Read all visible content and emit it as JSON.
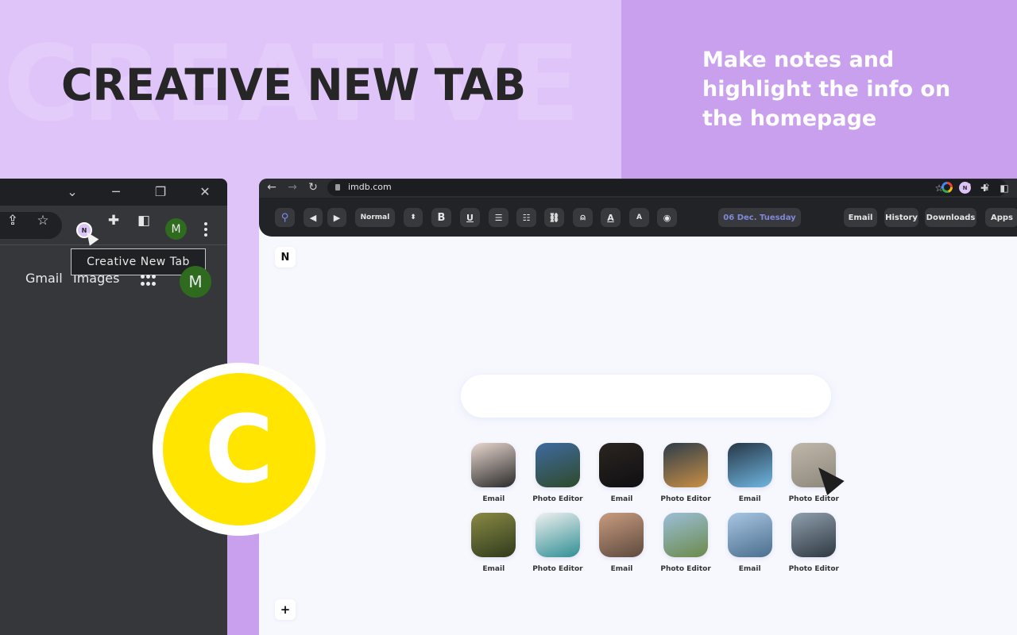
{
  "hero": {
    "watermark": "CREATIVE",
    "title": "CREATIVE NEW TAB",
    "tagline": "Make notes and highlight the info on the homepage"
  },
  "colors": {
    "bg_light_purple": "#dfc4fa",
    "bg_purple": "#c8a0ee",
    "logo_yellow": "#ffe500",
    "date_accent": "#8088d9",
    "search_icon_accent": "#7b8cf0",
    "dark_window": "#36373b"
  },
  "left_browser": {
    "window_controls": [
      "tab-search",
      "minimize",
      "restore",
      "close"
    ],
    "toolbar_icons": [
      "share-icon",
      "star-icon",
      "extension-badge",
      "puzzle-icon",
      "side-panel-icon",
      "profile-avatar",
      "more-menu-icon"
    ],
    "extension_badge_letter": "N",
    "profile_initial": "M",
    "tooltip": "Creative New Tab",
    "links": {
      "gmail": "Gmail",
      "images": "Images"
    },
    "account_initial": "M"
  },
  "main_browser": {
    "url": "imdb.com",
    "extension_badge_letter": "N",
    "toolbar": {
      "search_icon": "search-icon",
      "prev_icon": "prev-icon",
      "next_icon": "next-icon",
      "text_style": "Normal",
      "size_icon": "size-stepper-icon",
      "bold": "B",
      "underline": "U",
      "bullet_list": "bullet-list-icon",
      "numbered_list": "numbered-list-icon",
      "link": "link-icon",
      "reminder": "bell-icon",
      "text_color": "A",
      "highlight": "A",
      "preview": "eye-icon"
    },
    "date": "06 Dec. Tuesday",
    "quick_links": [
      "Email",
      "History",
      "Downloads",
      "Apps"
    ],
    "note_button": "N",
    "add_button": "+",
    "search": {
      "value": "",
      "placeholder": ""
    },
    "tiles": [
      {
        "label": "Email",
        "colors": [
          "#e8d7cf",
          "#2a2a2a"
        ]
      },
      {
        "label": "Photo Editor",
        "colors": [
          "#3f6aa0",
          "#2f4a2a"
        ]
      },
      {
        "label": "Email",
        "colors": [
          "#2b2520",
          "#0f0f12"
        ]
      },
      {
        "label": "Photo Editor",
        "colors": [
          "#2d3c4a",
          "#c98f45"
        ]
      },
      {
        "label": "Email",
        "colors": [
          "#263646",
          "#6fb6e0"
        ]
      },
      {
        "label": "Photo Editor",
        "colors": [
          "#bfb7aa",
          "#8d877b"
        ]
      },
      {
        "label": "Email",
        "colors": [
          "#8a8a44",
          "#2f3a1c"
        ]
      },
      {
        "label": "Photo Editor",
        "colors": [
          "#f0f0f0",
          "#2f8f94"
        ]
      },
      {
        "label": "Email",
        "colors": [
          "#c99b7f",
          "#5d4a3e"
        ]
      },
      {
        "label": "Photo Editor",
        "colors": [
          "#9bbfd8",
          "#6b8a4a"
        ]
      },
      {
        "label": "Email",
        "colors": [
          "#a8c6e3",
          "#4a6e8c"
        ]
      },
      {
        "label": "Photo Editor",
        "colors": [
          "#8fa0ad",
          "#2f3842"
        ]
      }
    ]
  },
  "logo": {
    "letter": "C"
  }
}
